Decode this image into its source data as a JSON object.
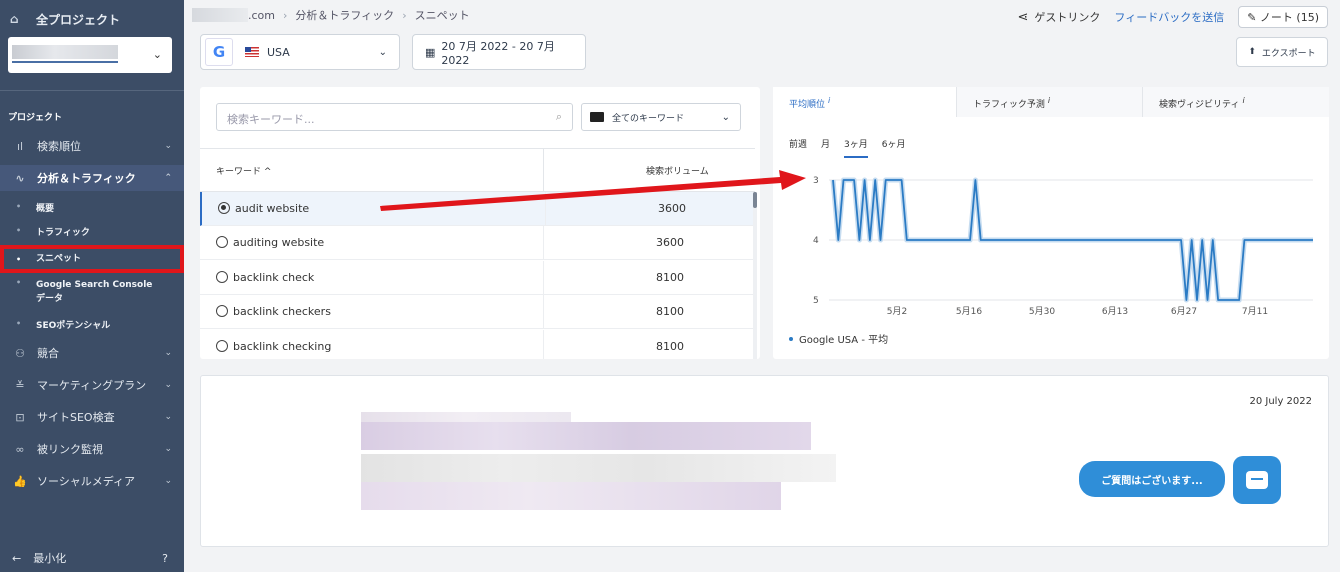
{
  "sidebar": {
    "all_projects": "全プロジェクト",
    "section_label": "プロジェクト",
    "items": [
      {
        "label": "検索順位"
      },
      {
        "label": "分析＆トラフィック"
      },
      {
        "label": "競合"
      },
      {
        "label": "マーケティングプラン"
      },
      {
        "label": "サイトSEO検査"
      },
      {
        "label": "被リンク監視"
      },
      {
        "label": "ソーシャルメディア"
      }
    ],
    "subitems": [
      {
        "label": "概要"
      },
      {
        "label": "トラフィック"
      },
      {
        "label": "スニペット"
      },
      {
        "label": "Google Search Console データ"
      },
      {
        "label": "SEOポテンシャル"
      }
    ],
    "minimize": "最小化",
    "help": "?"
  },
  "header": {
    "domain_suffix": ".com",
    "crumb_1": "分析＆トラフィック",
    "crumb_2": "スニペット",
    "guest_link": "ゲストリンク",
    "feedback": "フィードバックを送信",
    "note": "ノート (15)",
    "export": "エクスポート"
  },
  "toolbar": {
    "engine_letter": "G",
    "country": "USA",
    "date_range": "20 7月 2022 - 20 7月 2022"
  },
  "keywords": {
    "search_placeholder": "検索キーワード...",
    "folder": "全てのキーワード",
    "col_keyword": "キーワード ^",
    "col_volume": "検索ボリューム",
    "rows": [
      {
        "keyword": "audit website",
        "volume": "3600",
        "selected": true
      },
      {
        "keyword": "auditing website",
        "volume": "3600"
      },
      {
        "keyword": "backlink check",
        "volume": "8100"
      },
      {
        "keyword": "backlink checkers",
        "volume": "8100"
      },
      {
        "keyword": "backlink checking",
        "volume": "8100"
      }
    ]
  },
  "chart_tabs": {
    "avg_position": "平均順位",
    "traffic_forecast": "トラフィック予測",
    "visibility": "検索ヴィジビリティ",
    "info": "i"
  },
  "periods": [
    "前週",
    "月",
    "3ヶ月",
    "6ヶ月"
  ],
  "active_period": "3ヶ月",
  "chart_data": {
    "type": "line",
    "x_ticks": [
      "5月2",
      "5月16",
      "5月30",
      "6月13",
      "6月27",
      "7月11"
    ],
    "y_ticks": [
      "3",
      "4",
      "5"
    ],
    "ylim": [
      3,
      5
    ],
    "y_inverted": true,
    "series": [
      {
        "name": "Google USA - 平均",
        "color": "#2b7bc4",
        "points": [
          [
            0,
            3
          ],
          [
            1,
            4
          ],
          [
            2,
            3
          ],
          [
            4,
            3
          ],
          [
            5,
            4
          ],
          [
            6,
            3
          ],
          [
            7,
            4
          ],
          [
            8,
            3
          ],
          [
            9,
            4
          ],
          [
            10,
            3
          ],
          [
            13,
            3
          ],
          [
            14,
            4
          ],
          [
            26,
            4
          ],
          [
            27,
            3
          ],
          [
            28,
            4
          ],
          [
            66,
            4
          ],
          [
            67,
            5
          ],
          [
            68,
            4
          ],
          [
            69,
            5
          ],
          [
            70,
            4
          ],
          [
            71,
            5
          ],
          [
            72,
            4
          ],
          [
            73,
            5
          ],
          [
            77,
            5
          ],
          [
            78,
            4
          ],
          [
            91,
            4
          ]
        ]
      }
    ]
  },
  "snippet": {
    "date": "20 July 2022"
  },
  "chat": {
    "bubble": "ご質問はございます..."
  }
}
